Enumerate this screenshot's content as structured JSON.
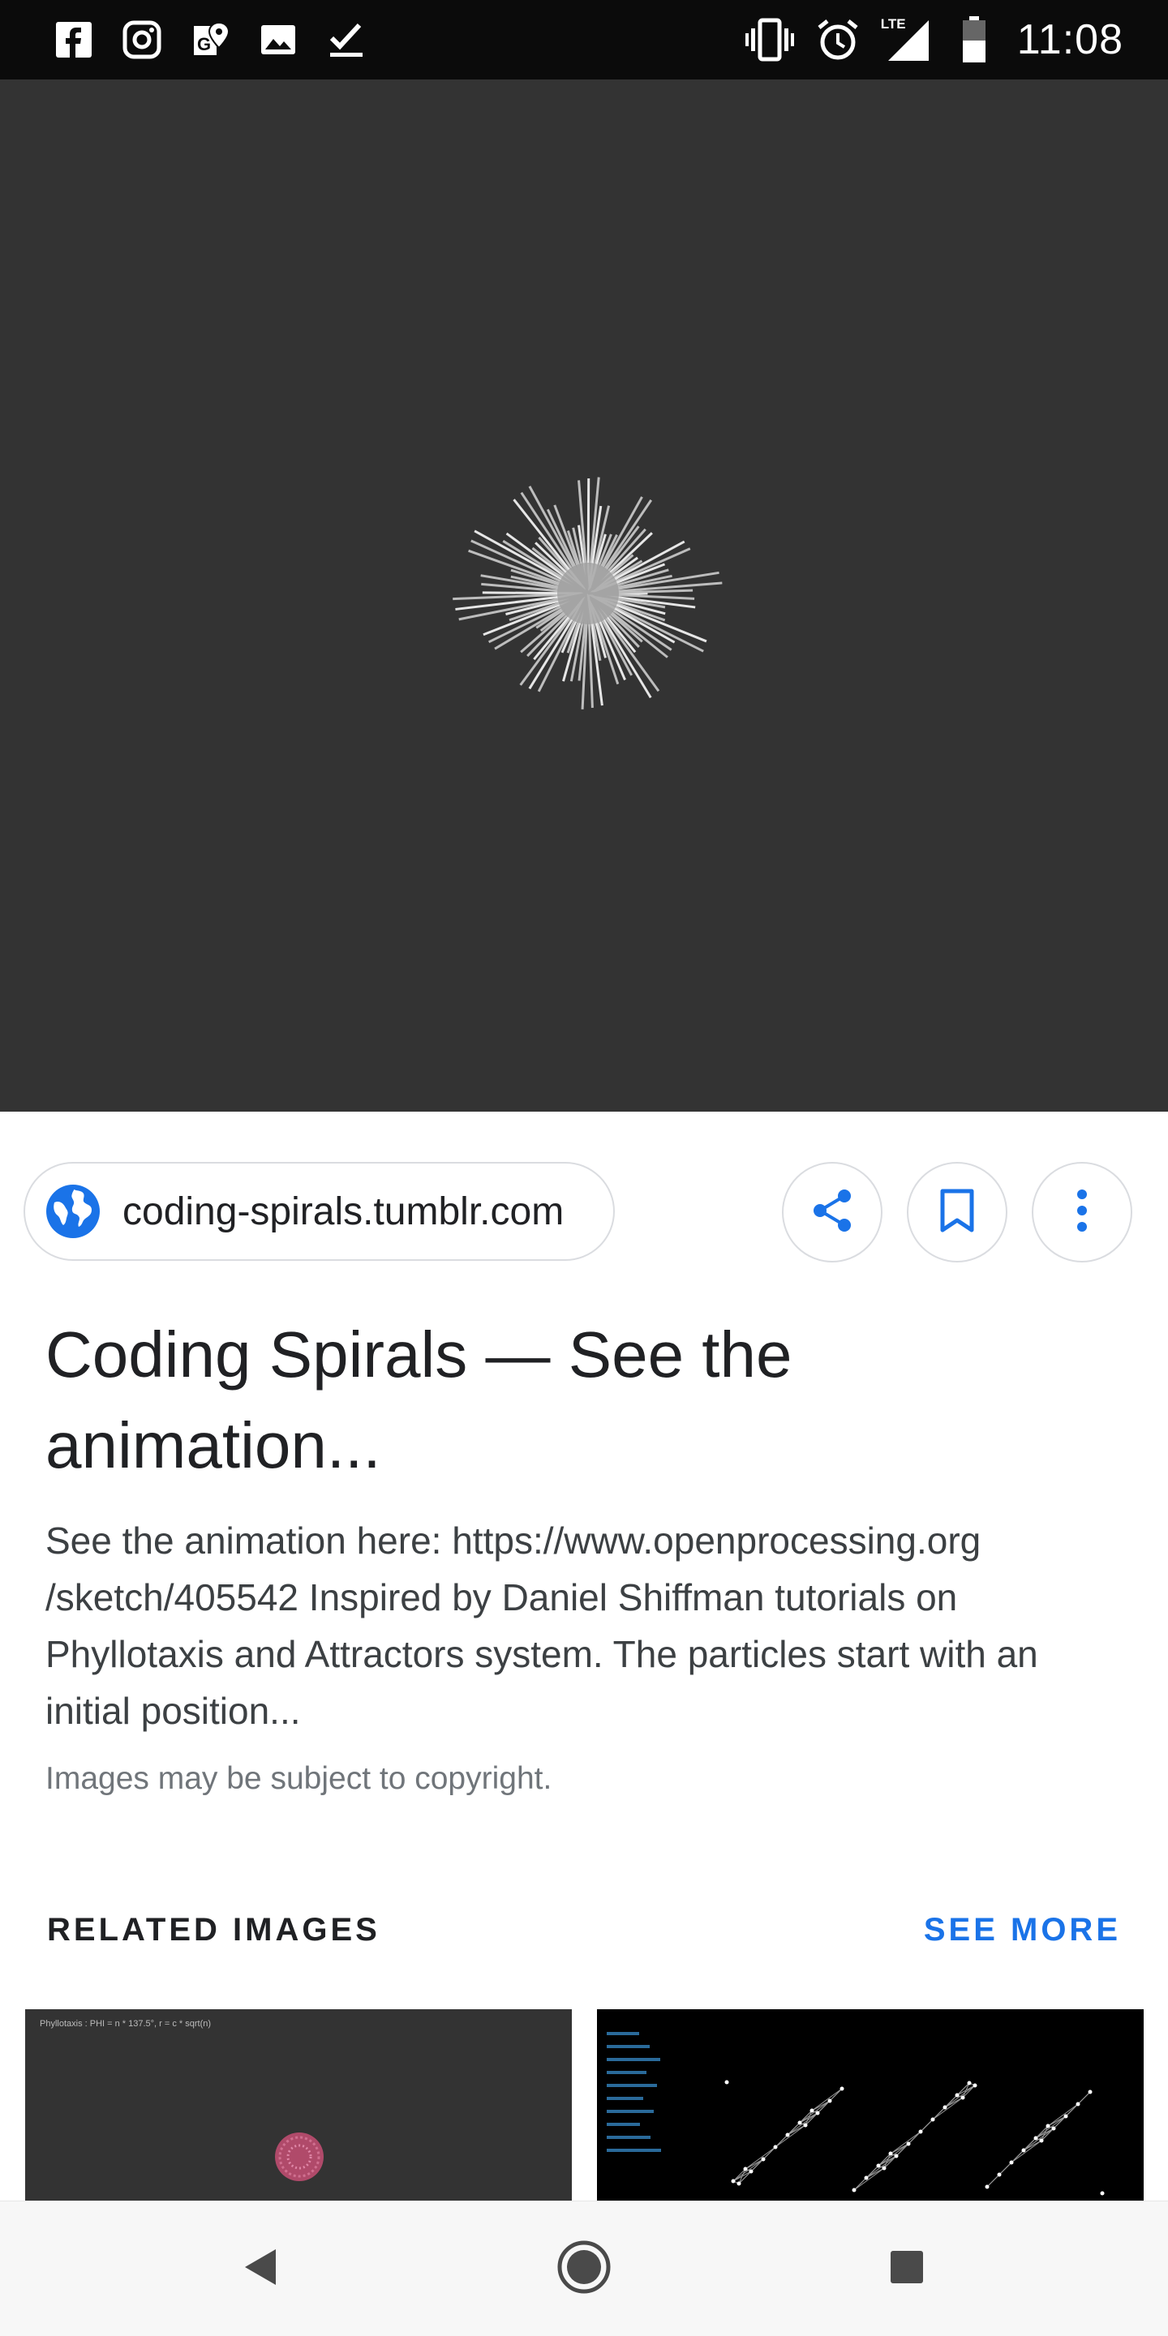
{
  "status_bar": {
    "time": "11:08",
    "left_icons": [
      "facebook-icon",
      "instagram-icon",
      "maps-icon",
      "photos-icon",
      "tasks-check-icon"
    ],
    "right_icons": [
      "vibrate-icon",
      "alarm-icon",
      "lte-signal-icon",
      "battery-icon"
    ],
    "lte_label": "LTE"
  },
  "image_viewer": {
    "background": "#333333"
  },
  "source": {
    "domain": "coding-spirals.tumblr.com"
  },
  "actions": {
    "share": "share-icon",
    "save": "bookmark-icon",
    "more": "more-vert-icon"
  },
  "result": {
    "title": "Coding Spirals — See the animation...",
    "description": "See the animation here: https://www.openprocessing.org /sketch/405542 Inspired by Daniel Shiffman tutorials on Phyllotaxis and Attractors system. The particles start with an initial position...",
    "copyright_note": "Images may be subject to copyright."
  },
  "related": {
    "heading": "RELATED IMAGES",
    "see_more": "SEE MORE",
    "thumbnails": [
      {
        "caption": "Phyllotaxis : PHI = n * 137.5°, r = c * sqrt(n)"
      },
      {
        "caption": ""
      }
    ]
  },
  "colors": {
    "accent": "#1a73e8",
    "status_bar": "#0b0b0b",
    "nav_bar": "#f7f7f7"
  }
}
